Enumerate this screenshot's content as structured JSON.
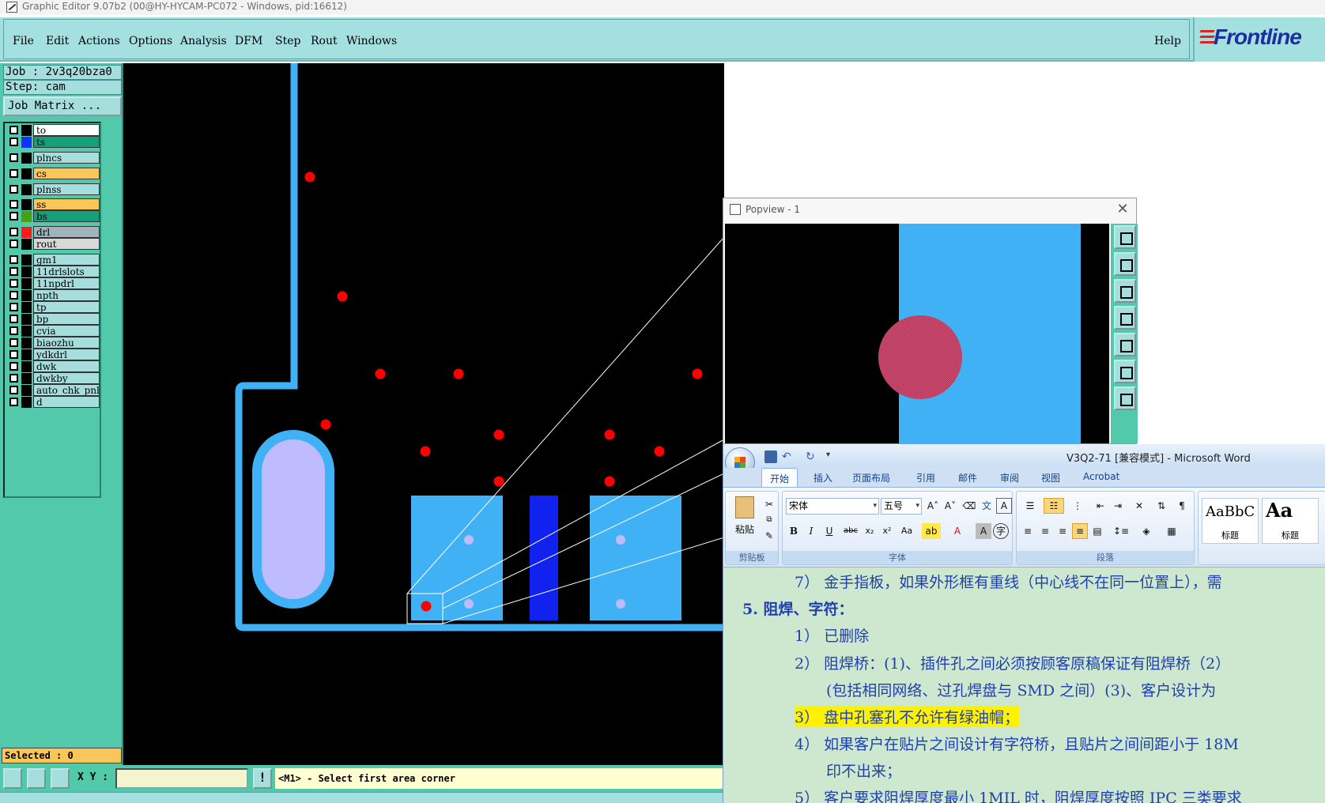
{
  "window": {
    "title": "Graphic Editor 9.07b2 (00@HY-HYCAM-PC072 - Windows, pid:16612)"
  },
  "menubar": {
    "items": [
      "File",
      "Edit",
      "Actions",
      "Options",
      "Analysis",
      "DFM",
      "Step",
      "Rout",
      "Windows"
    ],
    "help": "Help",
    "logo": "Frontline"
  },
  "left_panel": {
    "job": "Job : 2v3q20bza0",
    "step": "Step: cam",
    "job_matrix": "Job Matrix ...",
    "layers": [
      {
        "name": "to",
        "color": "#ffffff",
        "swatch": "#000000"
      },
      {
        "name": "ts",
        "color": "#13a07a",
        "swatch": "#1432ff"
      },
      {
        "name": "plncs",
        "color": "#a6dede",
        "swatch": "#000000"
      },
      {
        "name": "cs",
        "color": "#f9c65a",
        "swatch": "#000000"
      },
      {
        "name": "plnss",
        "color": "#a6dede",
        "swatch": "#000000"
      },
      {
        "name": "ss",
        "color": "#f9c65a",
        "swatch": "#000000"
      },
      {
        "name": "bs",
        "color": "#13a07a",
        "swatch": "#46a012"
      },
      {
        "name": "drl",
        "color": "#9fb3b9",
        "swatch": "#ff1a1a"
      },
      {
        "name": "rout",
        "color": "#d8d8d8",
        "swatch": "#000000"
      },
      {
        "name": "gm1",
        "color": "#a6dede",
        "swatch": "#000000"
      },
      {
        "name": "11drlslots",
        "color": "#a6dede",
        "swatch": "#000000"
      },
      {
        "name": "11npdrl",
        "color": "#a6dede",
        "swatch": "#000000"
      },
      {
        "name": "npth",
        "color": "#a6dede",
        "swatch": "#000000"
      },
      {
        "name": "tp",
        "color": "#a6dede",
        "swatch": "#000000"
      },
      {
        "name": "bp",
        "color": "#a6dede",
        "swatch": "#000000"
      },
      {
        "name": "cvia",
        "color": "#a6dede",
        "swatch": "#000000"
      },
      {
        "name": "biaozhu",
        "color": "#a6dede",
        "swatch": "#000000"
      },
      {
        "name": "ydkdrl",
        "color": "#a6dede",
        "swatch": "#000000"
      },
      {
        "name": "dwk",
        "color": "#a6dede",
        "swatch": "#000000"
      },
      {
        "name": "dwkby",
        "color": "#a6dede",
        "swatch": "#000000"
      },
      {
        "name": "auto_chk_pnl",
        "color": "#a6dede",
        "swatch": "#000000"
      },
      {
        "name": "d",
        "color": "#a6dede",
        "swatch": "#000000"
      }
    ],
    "selected": "Selected : 0"
  },
  "statusbar": {
    "xy_label": "X Y :",
    "xy_value": "",
    "excl": "!",
    "message": "<M1> - Select first area corner"
  },
  "popview": {
    "title": "Popview - 1",
    "close": "✕"
  },
  "word": {
    "title": "V3Q2-71 [兼容模式] - Microsoft Word",
    "tabs": [
      "开始",
      "插入",
      "页面布局",
      "引用",
      "邮件",
      "审阅",
      "视图",
      "Acrobat"
    ],
    "clipboard": {
      "paste": "粘贴",
      "label": "剪贴板"
    },
    "font": {
      "name": "宋体",
      "size": "五号",
      "label": "字体"
    },
    "paragraph": {
      "label": "段落"
    },
    "styles": [
      {
        "sample": "AaBbC",
        "name": "标题"
      },
      {
        "sample": "Aa",
        "name": "标题"
      }
    ],
    "doc_lines": [
      "7） 金手指板，如果外形框有重线（中心线不在同一位置上），需",
      "5.  阻焊、字符：",
      "1） 已删除",
      "2） 阻焊桥：(1)、插件孔之间必须按顾客原稿保证有阻焊桥（2）",
      "(包括相同网络、过孔焊盘与 SMD 之间）(3)、客户设计为",
      "3） 盘中孔塞孔不允许有绿油帽；",
      "4） 如果客户在贴片之间设计有字符桥，且贴片之间间距小于 18M",
      "印不出来；",
      "5） 客户要求阻焊厚度最小 1MIL 时，阻焊厚度按照 IPC 三类要求"
    ]
  },
  "colors": {
    "canvas_bg": "#000000",
    "board": "#40b1f4",
    "drill": "#ff0000",
    "panel": "#52c9aa",
    "menu": "#a5e0e1",
    "highlight": "#fff200"
  }
}
